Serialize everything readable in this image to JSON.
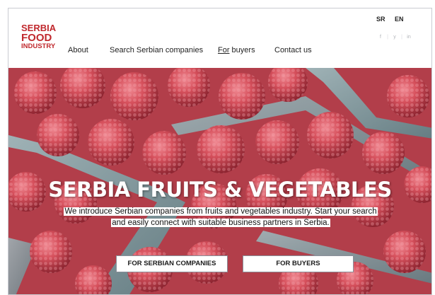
{
  "logo": {
    "line1": "SERBIA",
    "line2": "FOOD",
    "line3": "INDUSTRY"
  },
  "nav": {
    "about": "About",
    "search": "Search Serbian companies",
    "for_buyers_prefix": "For",
    "for_buyers_rest": " buyers",
    "contact": "Contact us"
  },
  "lang": {
    "sr": "SR",
    "en": "EN"
  },
  "social": [
    "f",
    "y",
    "in"
  ],
  "hero": {
    "title": "SERBIA FRUITS & VEGETABLES",
    "subtitle": "We introduce Serbian companies from fruits and vegetables industry. Start your search and easily connect with suitable business partners in Serbia.",
    "button_companies": "FOR SERBIAN COMPANIES",
    "button_buyers": "FOR BUYERS"
  },
  "colors": {
    "brand_red": "#c0282d",
    "hero_red": "#c94a55",
    "punnet_teal": "#7fa3a8"
  }
}
